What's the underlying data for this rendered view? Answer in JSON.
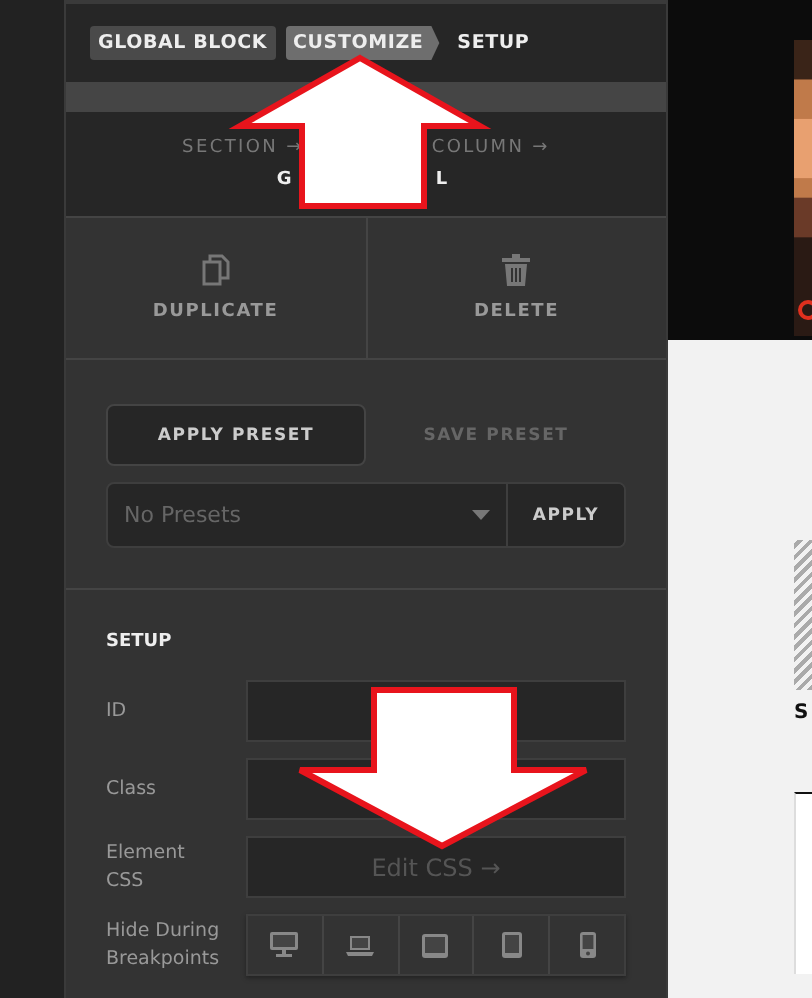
{
  "tabs": [
    {
      "label": "GLOBAL BLOCK",
      "selected": false
    },
    {
      "label": "CUSTOMIZE",
      "selected": true
    },
    {
      "label": "SETUP",
      "selected": false
    }
  ],
  "breadcrumb": {
    "items": [
      "SECTION →",
      "COLUMN →"
    ],
    "current_parts": [
      "G",
      "L"
    ]
  },
  "actions": [
    {
      "kind": "duplicate",
      "label": "DUPLICATE"
    },
    {
      "kind": "delete",
      "label": "DELETE"
    }
  ],
  "presets": {
    "tabs": [
      {
        "label": "APPLY PRESET",
        "selected": true
      },
      {
        "label": "SAVE PRESET",
        "selected": false
      }
    ],
    "select_placeholder": "No Presets",
    "apply": "APPLY"
  },
  "setup": {
    "title": "SETUP",
    "fields": [
      {
        "kind": "input",
        "label": "ID"
      },
      {
        "kind": "input",
        "label": "Class"
      },
      {
        "kind": "button",
        "label": "Element CSS",
        "button": "Edit CSS →"
      },
      {
        "kind": "breakpoints",
        "label": "Hide During Breakpoints",
        "devices": [
          {
            "kind": "desktop"
          },
          {
            "kind": "laptop"
          },
          {
            "kind": "tablet-landscape"
          },
          {
            "kind": "tablet"
          },
          {
            "kind": "phone"
          }
        ]
      }
    ]
  },
  "preview": {
    "cut_text": "S"
  }
}
